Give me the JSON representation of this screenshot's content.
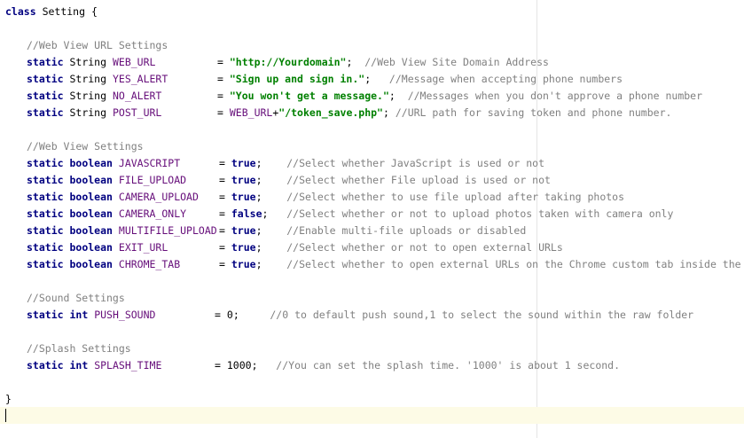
{
  "code": {
    "class_decl": {
      "kw": "class",
      "name": "Setting",
      "brace": "{"
    },
    "closing_brace": "}",
    "sections": [
      {
        "comment": "//Web View URL Settings",
        "lines": [
          {
            "mods": "static",
            "type": "String",
            "name": "WEB_URL",
            "eq": "=",
            "value": "\"http://Yourdomain\"",
            "end": ";",
            "comment": "//Web View Site Domain Address"
          },
          {
            "mods": "static",
            "type": "String",
            "name": "YES_ALERT",
            "eq": "=",
            "value": "\"Sign up and sign in.\"",
            "end": ";",
            "comment": "//Message when accepting phone numbers"
          },
          {
            "mods": "static",
            "type": "String",
            "name": "NO_ALERT",
            "eq": "=",
            "value": "\"You won't get a message.\"",
            "end": ";",
            "comment": "//Messages when you don't approve a phone number"
          },
          {
            "mods": "static",
            "type": "String",
            "name": "POST_URL",
            "eq": "=",
            "expr_field": "WEB_URL",
            "expr_op": "+",
            "value": "\"/token_save.php\"",
            "end": ";",
            "comment": "//URL path for saving token and phone number."
          }
        ]
      },
      {
        "comment": "//Web View Settings",
        "lines": [
          {
            "mods": "static",
            "type": "boolean",
            "name": "JAVASCRIPT",
            "eq": "=",
            "value": "true",
            "end": ";",
            "comment": "//Select whether JavaScript is used or not"
          },
          {
            "mods": "static",
            "type": "boolean",
            "name": "FILE_UPLOAD",
            "eq": "=",
            "value": "true",
            "end": ";",
            "comment": "//Select whether File upload is used or not"
          },
          {
            "mods": "static",
            "type": "boolean",
            "name": "CAMERA_UPLOAD",
            "eq": "=",
            "value": "true",
            "end": ";",
            "comment": "//Select whether to use file upload after taking photos"
          },
          {
            "mods": "static",
            "type": "boolean",
            "name": "CAMERA_ONLY",
            "eq": "=",
            "value": "false",
            "end": ";",
            "comment": "//Select whether or not to upload photos taken with camera only"
          },
          {
            "mods": "static",
            "type": "boolean",
            "name": "MULTIFILE_UPLOAD",
            "eq": "=",
            "value": "true",
            "end": ";",
            "comment": "//Enable multi-file uploads or disabled"
          },
          {
            "mods": "static",
            "type": "boolean",
            "name": "EXIT_URL",
            "eq": "=",
            "value": "true",
            "end": ";",
            "comment": "//Select whether or not to open external URLs"
          },
          {
            "mods": "static",
            "type": "boolean",
            "name": "CHROME_TAB",
            "eq": "=",
            "value": "true",
            "end": ";",
            "comment": "//Select whether to open external URLs on the Chrome custom tab inside the app"
          }
        ]
      },
      {
        "comment": "//Sound Settings",
        "lines": [
          {
            "mods": "static",
            "type": "int",
            "name": "PUSH_SOUND",
            "eq": "=",
            "value": "0",
            "end": ";",
            "comment": "//0 to default push sound,1 to select the sound within the raw folder"
          }
        ]
      },
      {
        "comment": "//Splash Settings",
        "lines": [
          {
            "mods": "static",
            "type": "int",
            "name": "SPLASH_TIME",
            "eq": "=",
            "value": "1000",
            "end": ";",
            "comment": "//You can set the splash time. '1000' is about 1 second."
          }
        ]
      }
    ]
  },
  "colors": {
    "keyword": "#000080",
    "field": "#660e7a",
    "string": "#008000",
    "comment": "#808080",
    "current_line": "#fdfbe6"
  }
}
